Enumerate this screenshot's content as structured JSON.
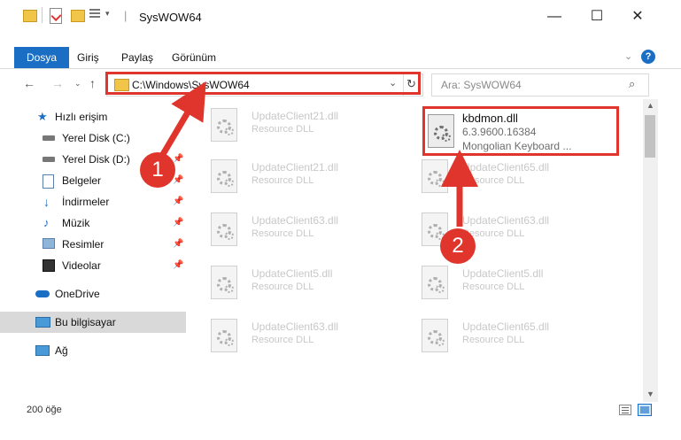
{
  "window": {
    "title": "SysWOW64",
    "minimize": "—",
    "maximize": "☐",
    "close": "✕"
  },
  "ribbon": {
    "tabs": [
      "Dosya",
      "Giriş",
      "Paylaş",
      "Görünüm"
    ],
    "help": "?"
  },
  "address": {
    "path": "C:\\Windows\\SysWOW64",
    "search_placeholder": "Ara: SysWOW64"
  },
  "nav": {
    "items": [
      {
        "label": "Hızlı erişim",
        "icon": "star-icon"
      },
      {
        "label": "Yerel Disk (C:)",
        "icon": "drive-icon"
      },
      {
        "label": "Yerel Disk (D:)",
        "icon": "drive-icon"
      },
      {
        "label": "Belgeler",
        "icon": "documents-icon"
      },
      {
        "label": "İndirmeler",
        "icon": "download-icon"
      },
      {
        "label": "Müzik",
        "icon": "music-icon"
      },
      {
        "label": "Resimler",
        "icon": "pictures-icon"
      },
      {
        "label": "Videolar",
        "icon": "video-icon"
      },
      {
        "label": "OneDrive",
        "icon": "cloud-icon"
      },
      {
        "label": "Bu bilgisayar",
        "icon": "computer-icon"
      },
      {
        "label": "Ağ",
        "icon": "network-icon"
      }
    ]
  },
  "files": {
    "left": [
      {
        "name": "UpdateClient21.dll",
        "desc": "Resource DLL"
      },
      {
        "name": "UpdateClient21.dll",
        "desc": "Resource DLL"
      },
      {
        "name": "UpdateClient63.dll",
        "desc": "Resource DLL"
      },
      {
        "name": "UpdateClient5.dll",
        "desc": "Resource DLL"
      },
      {
        "name": "UpdateClient63.dll",
        "desc": "Resource DLL"
      }
    ],
    "right": [
      {
        "name": "UpdateClient65.dll",
        "desc": "Resource DLL"
      },
      {
        "name": "UpdateClient63.dll",
        "desc": "Resource DLL"
      },
      {
        "name": "UpdateClient5.dll",
        "desc": "Resource DLL"
      },
      {
        "name": "UpdateClient65.dll",
        "desc": "Resource DLL"
      }
    ],
    "highlighted": {
      "name": "kbdmon.dll",
      "version": "6.3.9600.16384",
      "desc": "Mongolian Keyboard ..."
    }
  },
  "status": {
    "count": "200 öğe"
  },
  "annotations": {
    "step1": "1",
    "step2": "2"
  },
  "colors": {
    "accent": "#1a6fc4",
    "highlight": "#e0352d"
  }
}
